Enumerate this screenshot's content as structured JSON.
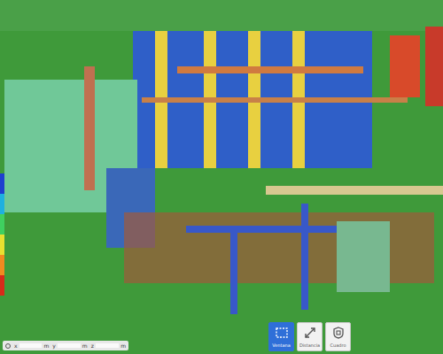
{
  "viewer": {
    "content": "point cloud scan"
  },
  "color_scale": [
    {
      "color": "#1f3fd0"
    },
    {
      "color": "#1fb0e0"
    },
    {
      "color": "#3fd060"
    },
    {
      "color": "#e8e030"
    },
    {
      "color": "#f08a20"
    },
    {
      "color": "#d82a1a"
    }
  ],
  "coordinates": [
    {
      "axis": "x",
      "unit": "m"
    },
    {
      "axis": "y",
      "unit": "m"
    },
    {
      "axis": "z",
      "unit": "m"
    }
  ],
  "tools": [
    {
      "label": "Ventana",
      "selected": true,
      "kind": "window"
    },
    {
      "label": "Distancia",
      "selected": false,
      "kind": "distance"
    },
    {
      "label": "Cuadro",
      "selected": false,
      "kind": "box"
    }
  ]
}
